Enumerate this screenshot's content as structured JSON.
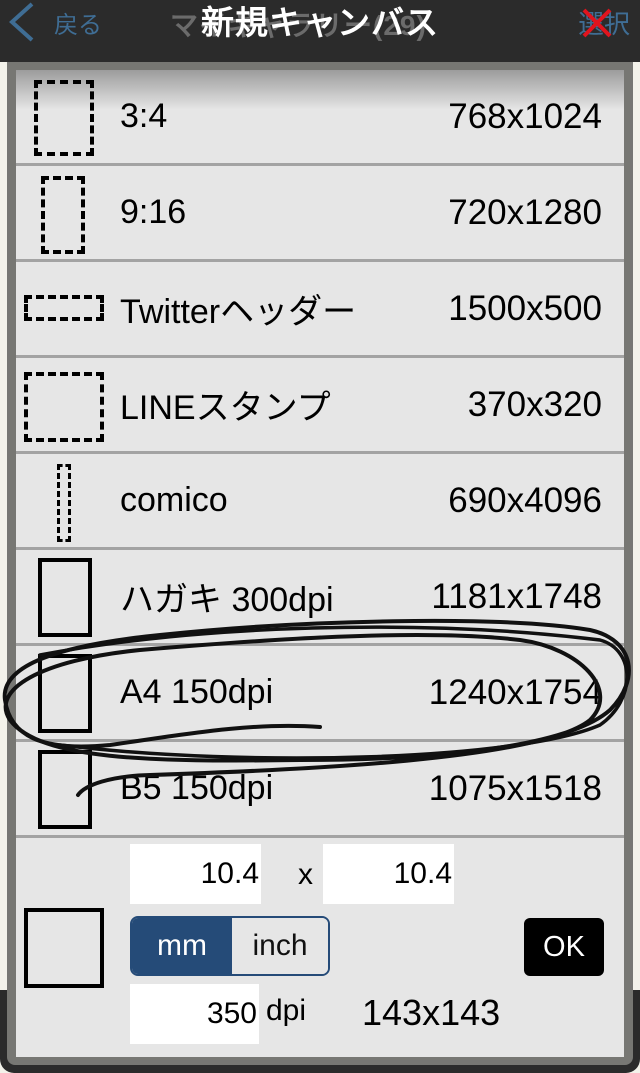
{
  "navbar": {
    "back_label": "戻る",
    "underlying_title": "マイギャラリー(29)",
    "select_label": "選択"
  },
  "modal": {
    "title": "新規キャンバス"
  },
  "presets": [
    {
      "label": "3:4",
      "size": "768x1024",
      "icon": "dashed-portrait"
    },
    {
      "label": "9:16",
      "size": "720x1280",
      "icon": "dashed-tall"
    },
    {
      "label": "Twitterヘッダー",
      "size": "1500x500",
      "icon": "dashed-wide"
    },
    {
      "label": "LINEスタンプ",
      "size": "370x320",
      "icon": "dashed-square"
    },
    {
      "label": "comico",
      "size": "690x4096",
      "icon": "dashed-very-tall"
    },
    {
      "label": "ハガキ 300dpi",
      "size": "1181x1748",
      "icon": "solid-portrait"
    },
    {
      "label": "A4 150dpi",
      "size": "1240x1754",
      "icon": "solid-portrait"
    },
    {
      "label": "B5 150dpi",
      "size": "1075x1518",
      "icon": "solid-portrait"
    }
  ],
  "custom": {
    "width_value": "10.4",
    "separator": "x",
    "height_value": "10.4",
    "units": [
      "mm",
      "inch"
    ],
    "selected_unit": "mm",
    "dpi_value": "350",
    "dpi_label": "dpi",
    "result_size": "143x143",
    "ok_label": "OK"
  },
  "colors": {
    "accent": "#254b78",
    "nav_link": "#3f6d94",
    "navbar_bg": "#2b2b2b",
    "panel_bg": "#e6e6e6",
    "annotation": "#000000",
    "cross_mark": "#e0141e"
  }
}
